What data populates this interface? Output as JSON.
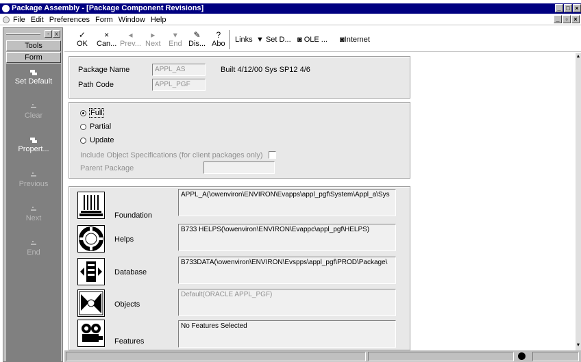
{
  "window": {
    "title": "Package Assembly - [Package Component Revisions]",
    "controls": [
      "_",
      "□",
      "×"
    ]
  },
  "menubar": {
    "items": [
      "File",
      "Edit",
      "Preferences",
      "Form",
      "Window",
      "Help"
    ],
    "mdi_controls": [
      "_",
      "▫",
      "×"
    ]
  },
  "left_panel": {
    "header_controls": [
      "-",
      "x"
    ],
    "tabs": [
      "Tools",
      "Form"
    ],
    "buttons": [
      {
        "label": "Set Default",
        "enabled": true
      },
      {
        "label": "Clear",
        "enabled": false
      },
      {
        "label": "Propert...",
        "enabled": true
      },
      {
        "label": "Previous",
        "enabled": false
      },
      {
        "label": "Next",
        "enabled": false
      },
      {
        "label": "End",
        "enabled": false
      }
    ]
  },
  "toolbar": {
    "buttons": [
      {
        "label": "OK",
        "icon": "check-icon",
        "enabled": true
      },
      {
        "label": "Can...",
        "icon": "x-icon",
        "enabled": true
      },
      {
        "label": "Prev...",
        "icon": "prev-icon",
        "enabled": false
      },
      {
        "label": "Next",
        "icon": "next-icon",
        "enabled": false
      },
      {
        "label": "End",
        "icon": "end-icon",
        "enabled": false
      },
      {
        "label": "Dis...",
        "icon": "display-icon",
        "enabled": true
      },
      {
        "label": "Abo",
        "icon": "about-icon",
        "enabled": true
      }
    ],
    "links": {
      "links_label": "Links",
      "setd_label": "Set D...",
      "ole_label": "OLE ...",
      "internet_label": "Internet"
    }
  },
  "package": {
    "name_label": "Package Name",
    "name_value": "APPL_AS",
    "build_info": "Built 4/12/00  Sys SP12 4/6",
    "path_label": "Path Code",
    "path_value": "APPL_PGF"
  },
  "options": {
    "full": "Full",
    "partial": "Partial",
    "update": "Update",
    "include_specs": "Include Object Specifications (for client packages only)",
    "parent_package": "Parent Package"
  },
  "components": [
    {
      "label": "Foundation",
      "icon": "foundation-icon",
      "value": "APPL_A(\\owenviron\\ENVIRON\\Evapps\\appl_pgf\\System\\Appl_a\\Sys",
      "dim": false
    },
    {
      "label": "Helps",
      "icon": "helps-icon",
      "value": "B733 HELPS(\\owenviron\\ENVIRON\\Evappc\\appl_pgf\\HELPS)",
      "dim": false
    },
    {
      "label": "Database",
      "icon": "database-icon",
      "value": "B733DATA(\\owenviron\\ENVIRON\\Evspps\\appl_pgf\\PROD\\Package\\",
      "dim": false
    },
    {
      "label": "Objects",
      "icon": "objects-icon",
      "value": "Default(ORACLE APPL_PGF)",
      "dim": true
    },
    {
      "label": "Features",
      "icon": "features-icon",
      "value": "No Features Selected",
      "dim": false
    }
  ]
}
